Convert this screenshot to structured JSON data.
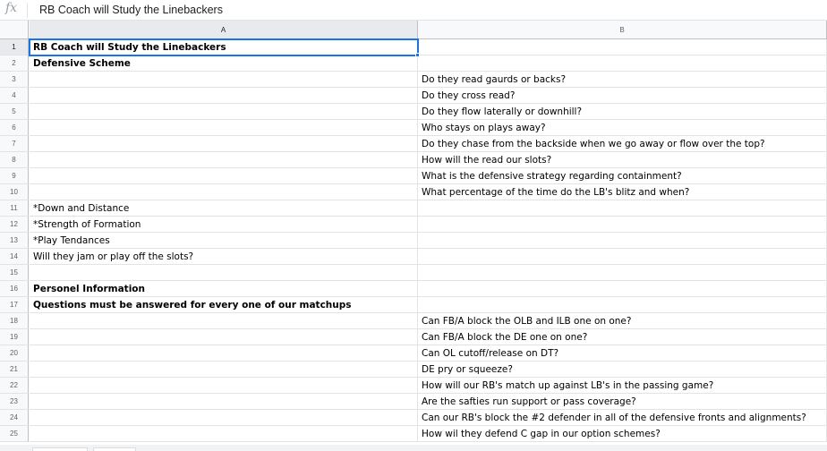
{
  "formula_bar": {
    "fx_label": "fx",
    "value": "RB Coach will Study the Linebackers"
  },
  "columns": [
    "A",
    "B"
  ],
  "rows": [
    {
      "num": "1",
      "a": "RB Coach will Study the Linebackers",
      "b": "",
      "a_bold": true
    },
    {
      "num": "2",
      "a": "Defensive Scheme",
      "b": "",
      "a_bold": true
    },
    {
      "num": "3",
      "a": "",
      "b": "Do they read gaurds or backs?"
    },
    {
      "num": "4",
      "a": "",
      "b": "Do they cross read?"
    },
    {
      "num": "5",
      "a": "",
      "b": "Do they flow laterally or downhill?"
    },
    {
      "num": "6",
      "a": "",
      "b": "Who stays on plays away?"
    },
    {
      "num": "7",
      "a": "",
      "b": "Do they chase from the backside when we go away or flow over the top?"
    },
    {
      "num": "8",
      "a": "",
      "b": "How will the read our slots?"
    },
    {
      "num": "9",
      "a": "",
      "b": "What is the defensive strategy regarding containment?"
    },
    {
      "num": "10",
      "a": "",
      "b": "What percentage of the time do the LB's blitz and when?"
    },
    {
      "num": "11",
      "a": "*Down and Distance",
      "b": ""
    },
    {
      "num": "12",
      "a": "*Strength of Formation",
      "b": ""
    },
    {
      "num": "13",
      "a": "*Play Tendances",
      "b": ""
    },
    {
      "num": "14",
      "a": "Will they jam or play off the slots?",
      "b": ""
    },
    {
      "num": "15",
      "a": "",
      "b": ""
    },
    {
      "num": "16",
      "a": "Personel Information",
      "b": "",
      "a_bold": true
    },
    {
      "num": "17",
      "a": "Questions must be answered for every one of our matchups",
      "b": "",
      "a_bold": true
    },
    {
      "num": "18",
      "a": "",
      "b": "Can FB/A block the OLB and ILB one on one?"
    },
    {
      "num": "19",
      "a": "",
      "b": "Can FB/A block the DE  one on one?"
    },
    {
      "num": "20",
      "a": "",
      "b": "Can OL cutoff/release on DT?"
    },
    {
      "num": "21",
      "a": "",
      "b": "DE pry or squeeze?"
    },
    {
      "num": "22",
      "a": "",
      "b": "How will our RB's match up against LB's in the passing game?"
    },
    {
      "num": "23",
      "a": "",
      "b": "Are the safties run support or pass coverage?"
    },
    {
      "num": "24",
      "a": "",
      "b": "Can our RB's block the #2 defender in all of the defensive fronts and alignments?"
    },
    {
      "num": "25",
      "a": "",
      "b": "How wil they defend C gap in our option schemes?"
    }
  ],
  "selection": {
    "cell": "A1",
    "accent": "#1a73e8"
  }
}
